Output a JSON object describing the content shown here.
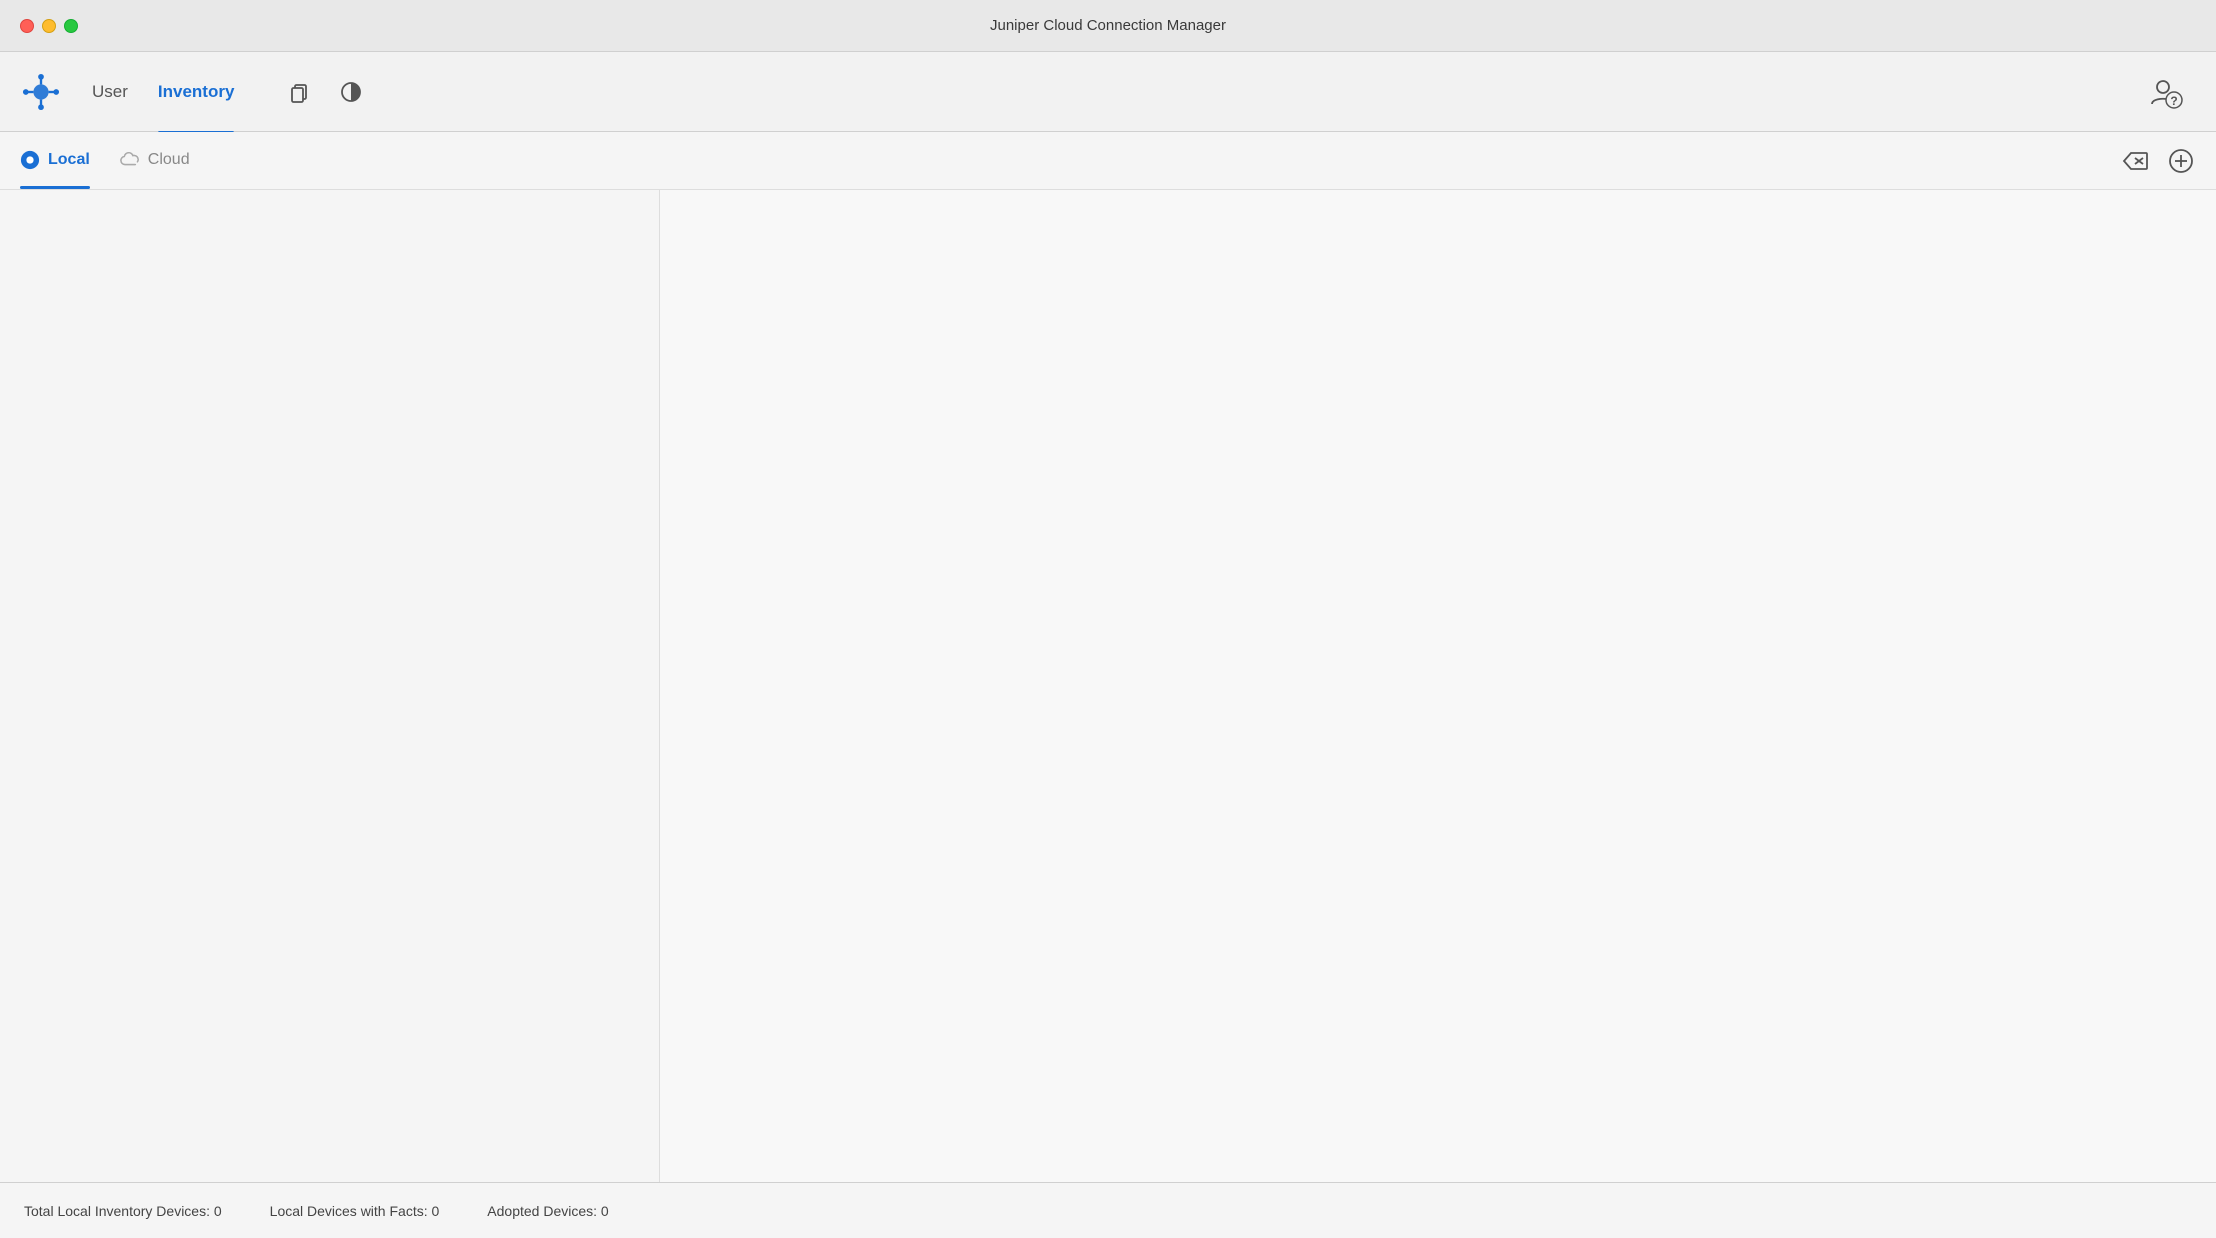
{
  "window": {
    "title": "Juniper Cloud Connection Manager"
  },
  "toolbar": {
    "logo_label": "Juniper Logo",
    "nav_items": [
      {
        "id": "user",
        "label": "User",
        "active": false
      },
      {
        "id": "inventory",
        "label": "Inventory",
        "active": true
      }
    ],
    "icons": [
      {
        "id": "copy",
        "symbol": "⧉"
      },
      {
        "id": "theme",
        "symbol": "◑"
      }
    ],
    "user_help_icon": "👤?"
  },
  "sub_tabs": {
    "tabs": [
      {
        "id": "local",
        "label": "Local",
        "active": true,
        "icon": "local"
      },
      {
        "id": "cloud",
        "label": "Cloud",
        "active": false,
        "icon": "cloud"
      }
    ],
    "actions": [
      {
        "id": "delete",
        "symbol": "⌫"
      },
      {
        "id": "add",
        "symbol": "⊕"
      }
    ]
  },
  "status_bar": {
    "total_label": "Total Local Inventory Devices: 0",
    "facts_label": "Local Devices with Facts: 0",
    "adopted_label": "Adopted Devices: 0"
  }
}
